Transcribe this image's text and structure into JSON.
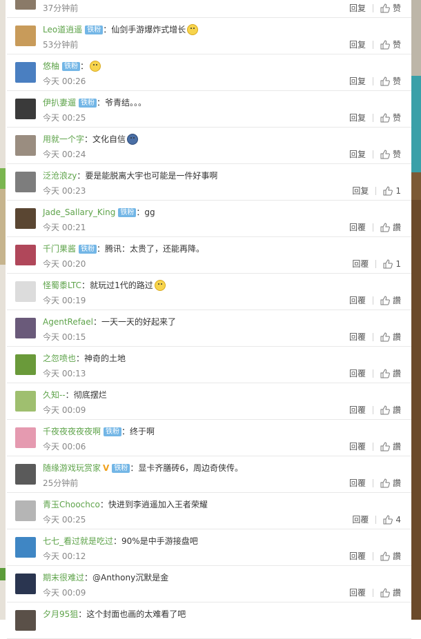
{
  "comments": [
    {
      "user": "",
      "badge": "",
      "text": "",
      "emoji": "",
      "time": "37分钟前",
      "reply": "回复",
      "likes": "赞",
      "avatar_color": "#8a7a68"
    },
    {
      "user": "Leo道逍遥",
      "badge": "铁粉",
      "text": "仙剑手游爆炸式增长",
      "emoji": "doge",
      "time": "53分钟前",
      "reply": "回复",
      "likes": "赞",
      "avatar_color": "#c89b5a"
    },
    {
      "user": "悠柚",
      "badge": "铁粉",
      "text": "",
      "emoji": "smile",
      "time": "今天 00:26",
      "reply": "回复",
      "likes": "赞",
      "avatar_color": "#4a7fc1"
    },
    {
      "user": "伊扒妻遛",
      "badge": "铁粉",
      "text": "爷青结。。。",
      "emoji": "",
      "time": "今天 00:25",
      "reply": "回复",
      "likes": "赞",
      "avatar_color": "#3a3a3a"
    },
    {
      "user": "用就一个字",
      "badge": "",
      "text": "文化自信",
      "emoji": "dark",
      "time": "今天 00:24",
      "reply": "回复",
      "likes": "赞",
      "avatar_color": "#9a8d80"
    },
    {
      "user": "泛沧浪zy",
      "badge": "",
      "text": "要是能脱离大宇也可能是一件好事啊",
      "emoji": "",
      "time": "今天 00:23",
      "reply": "回复",
      "likes": "1",
      "avatar_color": "#7d7d7d"
    },
    {
      "user": "Jade_Sallary_King",
      "badge": "铁粉",
      "text": "gg",
      "emoji": "",
      "time": "今天 00:21",
      "reply": "回覆",
      "likes": "讚",
      "avatar_color": "#5a4632"
    },
    {
      "user": "千门果酱",
      "badge": "铁粉",
      "text": "腾讯：太贵了，还能再降。",
      "emoji": "",
      "time": "今天 00:20",
      "reply": "回覆",
      "likes": "1",
      "avatar_color": "#b0475a"
    },
    {
      "user": "怪蜀黍LTC",
      "badge": "",
      "text": "就玩过1代的路过",
      "emoji": "smile",
      "time": "今天 00:19",
      "reply": "回覆",
      "likes": "讚",
      "avatar_color": "#dcdcdc"
    },
    {
      "user": "AgentRefael",
      "badge": "",
      "text": "一天一天的好起来了",
      "emoji": "",
      "time": "今天 00:15",
      "reply": "回覆",
      "likes": "讚",
      "avatar_color": "#6a5a7a"
    },
    {
      "user": "之忽喷也",
      "badge": "",
      "text": "神奇的土地",
      "emoji": "",
      "time": "今天 00:13",
      "reply": "回覆",
      "likes": "讚",
      "avatar_color": "#6a9a3a"
    },
    {
      "user": "久知--",
      "badge": "",
      "text": "彻底摆烂",
      "emoji": "",
      "time": "今天 00:09",
      "reply": "回覆",
      "likes": "讚",
      "avatar_color": "#9fbf6f"
    },
    {
      "user": "千夜夜夜夜夜啊",
      "badge": "铁粉",
      "text": "终于啊",
      "emoji": "",
      "time": "今天 00:06",
      "reply": "回覆",
      "likes": "讚",
      "avatar_color": "#e59ab0"
    },
    {
      "user": "随缘游戏玩赏家",
      "badge": "铁粉",
      "vip": "V",
      "text": "显卡齐膳砖6，周边奇侠传。",
      "emoji": "",
      "time": "25分钟前",
      "reply": "回覆",
      "likes": "讚",
      "avatar_color": "#5a5a5a"
    },
    {
      "user": "青玉Choochco",
      "badge": "",
      "text": "快进到李逍遥加入王者荣耀",
      "emoji": "",
      "time": "今天 00:25",
      "reply": "回覆",
      "likes": "4",
      "avatar_color": "#b5b5b5"
    },
    {
      "user": "七七_看过就是吃过",
      "badge": "",
      "text": "90%是中手游接盘吧",
      "emoji": "",
      "time": "今天 00:12",
      "reply": "回覆",
      "likes": "讚",
      "avatar_color": "#3f86c4"
    },
    {
      "user": "期末很难过",
      "badge": "",
      "text": "@Anthony沉默是金",
      "emoji": "",
      "time": "今天 00:09",
      "reply": "回覆",
      "likes": "讚",
      "avatar_color": "#2a3550"
    },
    {
      "user": "夕月95狙",
      "badge": "",
      "text": "这个封面也画的太难看了吧",
      "emoji": "",
      "time": "",
      "reply": "",
      "likes": "",
      "avatar_color": "#5a5048"
    }
  ]
}
